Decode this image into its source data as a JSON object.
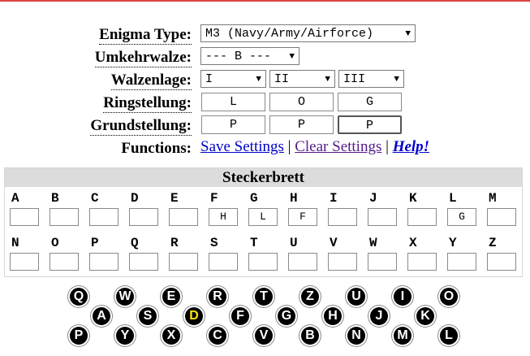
{
  "settings": {
    "type_label": "Enigma Type:",
    "type_value": "M3 (Navy/Army/Airforce)",
    "reflector_label": "Umkehrwalze:",
    "reflector_value": "--- B ---",
    "rotor_order_label": "Walzenlage:",
    "rotors": [
      "I",
      "II",
      "III"
    ],
    "ring_label": "Ringstellung:",
    "rings": [
      "L",
      "O",
      "G"
    ],
    "start_label": "Grundstellung:",
    "starts": [
      "P",
      "P",
      "P"
    ],
    "functions_label": "Functions:",
    "save": "Save Settings",
    "clear": "Clear Settings",
    "help": "Help!",
    "separator": "|"
  },
  "plugboard": {
    "title": "Steckerbrett",
    "row1": [
      {
        "letter": "A",
        "value": ""
      },
      {
        "letter": "B",
        "value": ""
      },
      {
        "letter": "C",
        "value": ""
      },
      {
        "letter": "D",
        "value": ""
      },
      {
        "letter": "E",
        "value": ""
      },
      {
        "letter": "F",
        "value": "H"
      },
      {
        "letter": "G",
        "value": "L"
      },
      {
        "letter": "H",
        "value": "F"
      },
      {
        "letter": "I",
        "value": ""
      },
      {
        "letter": "J",
        "value": ""
      },
      {
        "letter": "K",
        "value": ""
      },
      {
        "letter": "L",
        "value": "G"
      },
      {
        "letter": "M",
        "value": ""
      }
    ],
    "row2": [
      {
        "letter": "N",
        "value": ""
      },
      {
        "letter": "O",
        "value": ""
      },
      {
        "letter": "P",
        "value": ""
      },
      {
        "letter": "Q",
        "value": ""
      },
      {
        "letter": "R",
        "value": ""
      },
      {
        "letter": "S",
        "value": ""
      },
      {
        "letter": "T",
        "value": ""
      },
      {
        "letter": "U",
        "value": ""
      },
      {
        "letter": "V",
        "value": ""
      },
      {
        "letter": "W",
        "value": ""
      },
      {
        "letter": "X",
        "value": ""
      },
      {
        "letter": "Y",
        "value": ""
      },
      {
        "letter": "Z",
        "value": ""
      }
    ]
  },
  "lampboard": {
    "row1": [
      "Q",
      "W",
      "E",
      "R",
      "T",
      "Z",
      "U",
      "I",
      "O"
    ],
    "row2": [
      "A",
      "S",
      "D",
      "F",
      "G",
      "H",
      "J",
      "K"
    ],
    "row3": [
      "P",
      "Y",
      "X",
      "C",
      "V",
      "B",
      "N",
      "M",
      "L"
    ],
    "lit": "D",
    "lit_color": "#ffe800"
  }
}
